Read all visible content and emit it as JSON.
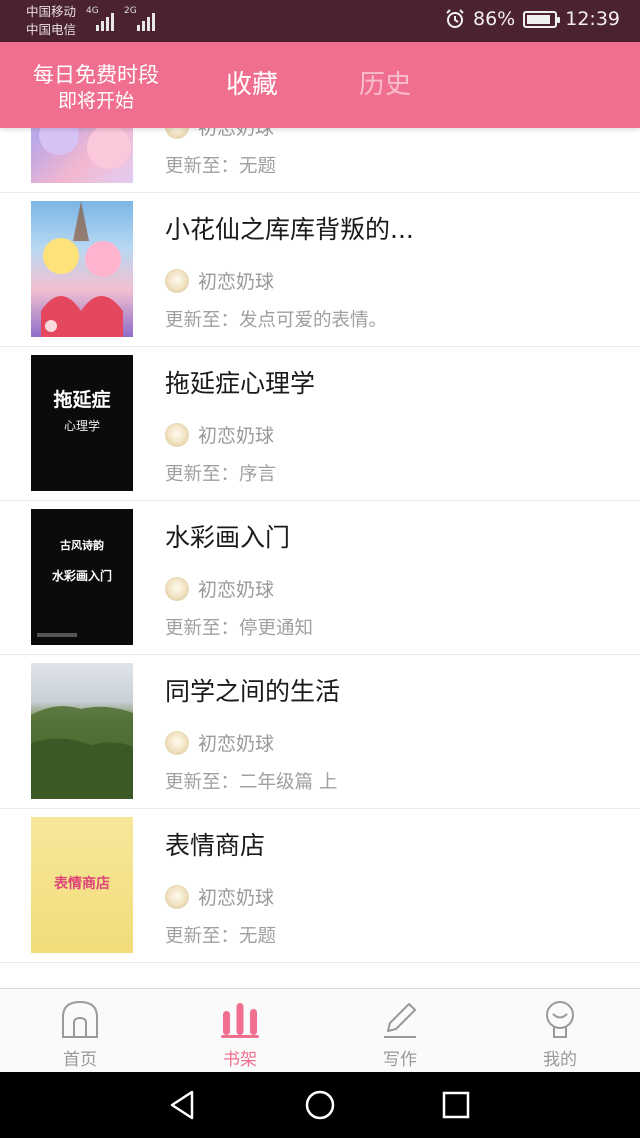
{
  "status_bar": {
    "carrier1": "中国移动",
    "carrier2": "中国电信",
    "net1": "4G",
    "net2": "2G",
    "battery": "86%",
    "battery_level": 0.86,
    "time": "12:39"
  },
  "header": {
    "free_line1": "每日免费时段",
    "free_line2": "即将开始",
    "tab_favorites": "收藏",
    "tab_history": "历史",
    "active_tab": "收藏"
  },
  "books": [
    {
      "title": "",
      "author": "初恋奶球",
      "update": "更新至：无题",
      "cover": "anime-girls-icon"
    },
    {
      "title": "小花仙之库库背叛的...",
      "author": "初恋奶球",
      "update": "更新至：发点可爱的表情。",
      "cover": "anime-fairies-icon"
    },
    {
      "title": "拖延症心理学",
      "author": "初恋奶球",
      "update": "更新至：序言",
      "cover": "text-cover",
      "cover_text1": "拖延症",
      "cover_text2": "心理学"
    },
    {
      "title": "水彩画入门",
      "author": "初恋奶球",
      "update": "更新至：停更通知",
      "cover": "text-cover",
      "cover_text1": "古风诗韵",
      "cover_text2": "水彩画入门"
    },
    {
      "title": "同学之间的生活",
      "author": "初恋奶球",
      "update": "更新至：二年级篇  上",
      "cover": "landscape-photo"
    },
    {
      "title": "表情商店",
      "author": "初恋奶球",
      "update": "更新至：无题",
      "cover": "text-cover",
      "cover_text1": "表情商店"
    }
  ],
  "bottom_nav": [
    {
      "label": "首页",
      "icon": "home-icon"
    },
    {
      "label": "书架",
      "icon": "bookshelf-icon",
      "active": true
    },
    {
      "label": "写作",
      "icon": "pencil-icon"
    },
    {
      "label": "我的",
      "icon": "profile-icon"
    }
  ],
  "colors": {
    "accent": "#f06f8e",
    "status_bar": "#4a2230",
    "text_primary": "#1a1a1a",
    "text_secondary": "#9a9a9a"
  }
}
